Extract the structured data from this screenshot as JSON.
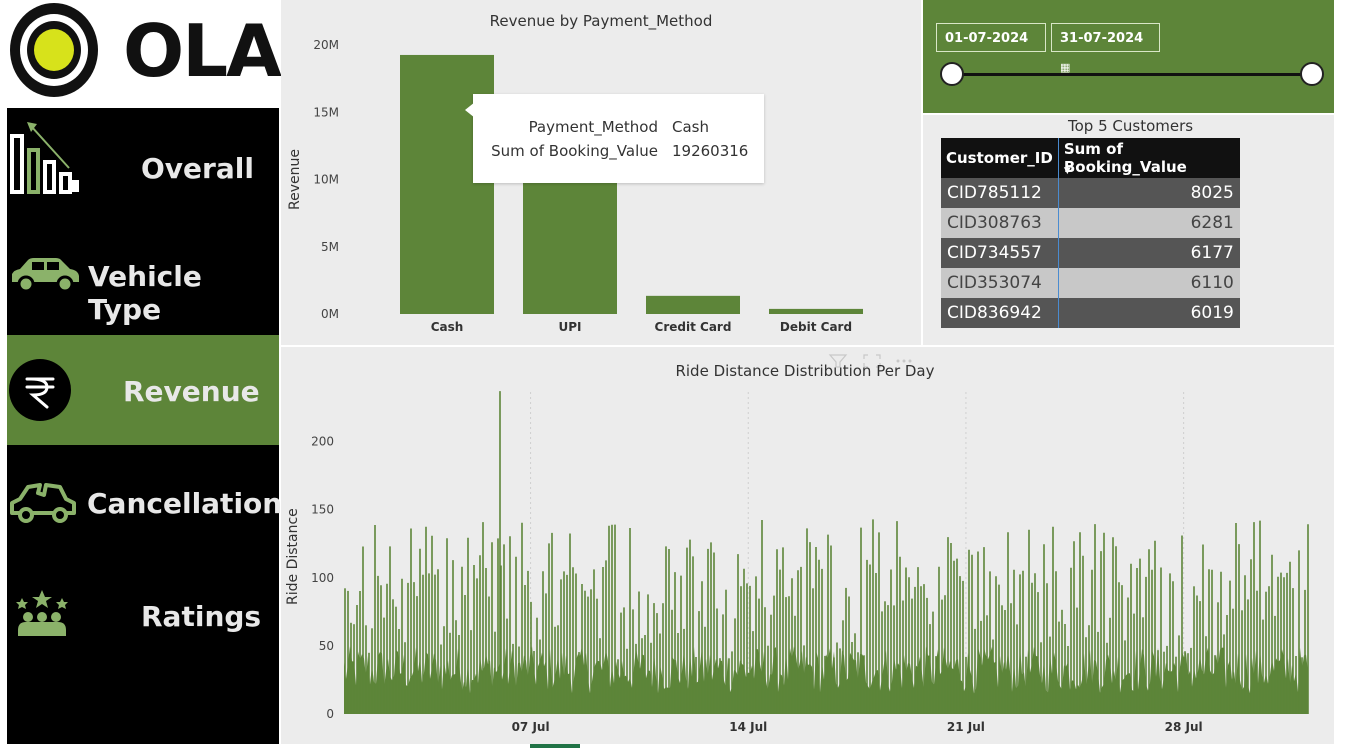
{
  "logo": {
    "text": "OLA"
  },
  "nav": {
    "items": [
      {
        "label": "Overall",
        "icon": "bar-chart-declining-icon",
        "active": false
      },
      {
        "label": "Vehicle Type",
        "icon": "car-icon",
        "active": false
      },
      {
        "label": "Revenue",
        "icon": "rupee-icon",
        "active": true
      },
      {
        "label": "Cancellation",
        "icon": "crashed-car-icon",
        "active": false
      },
      {
        "label": "Ratings",
        "icon": "star-team-icon",
        "active": false
      }
    ]
  },
  "colors": {
    "accent": "#5d8539",
    "sidebar": "#000000",
    "panel": "#ececec"
  },
  "date_filter": {
    "start": "01-07-2024",
    "end": "31-07-2024",
    "calendar_icon": "calendar-icon"
  },
  "revenue_chart": {
    "title": "Revenue by Payment_Method",
    "ylabel": "Revenue",
    "tooltip": {
      "rows": [
        {
          "key": "Payment_Method",
          "value": "Cash"
        },
        {
          "key": "Sum of Booking_Value",
          "value": "19260316"
        }
      ]
    }
  },
  "top5": {
    "title": "Top 5 Customers",
    "columns": [
      "Customer_ID",
      "Sum of Booking_Value"
    ],
    "sort_icon": "sort-descending-icon",
    "rows": [
      {
        "id": "CID785112",
        "value": "8025"
      },
      {
        "id": "CID308763",
        "value": "6281"
      },
      {
        "id": "CID734557",
        "value": "6177"
      },
      {
        "id": "CID353074",
        "value": "6110"
      },
      {
        "id": "CID836942",
        "value": "6019"
      }
    ]
  },
  "distance_chart": {
    "title": "Ride Distance Distribution Per Day",
    "ylabel": "Ride Distance",
    "header_icons": [
      "filter-icon",
      "focus-mode-icon",
      "more-options-icon"
    ]
  },
  "chart_data": [
    {
      "type": "bar",
      "title": "Revenue by Payment_Method",
      "xlabel": "",
      "ylabel": "Revenue",
      "categories": [
        "Cash",
        "UPI",
        "Credit Card",
        "Debit Card"
      ],
      "values": [
        19260316,
        11500000,
        1350000,
        380000
      ],
      "ylim": [
        0,
        20000000
      ],
      "yticks": [
        "0M",
        "5M",
        "10M",
        "15M",
        "20M"
      ],
      "ytick_values": [
        0,
        5000000,
        10000000,
        15000000,
        20000000
      ],
      "grid": false,
      "legend": "none"
    },
    {
      "type": "bar",
      "title": "Ride Distance Distribution Per Day",
      "xlabel": "",
      "ylabel": "Ride Distance",
      "x_range": [
        "2024-07-01",
        "2024-07-31"
      ],
      "xticks": [
        "07 Jul",
        "14 Jul",
        "21 Jul",
        "28 Jul"
      ],
      "ylim": [
        0,
        240
      ],
      "yticks": [
        "0",
        "50",
        "100",
        "150",
        "200"
      ],
      "ytick_values": [
        0,
        50,
        100,
        150,
        200
      ],
      "typical_band": [
        15,
        50
      ],
      "max_value": 237,
      "grid": "vertical dotted at weekly ticks",
      "legend": "none"
    }
  ]
}
